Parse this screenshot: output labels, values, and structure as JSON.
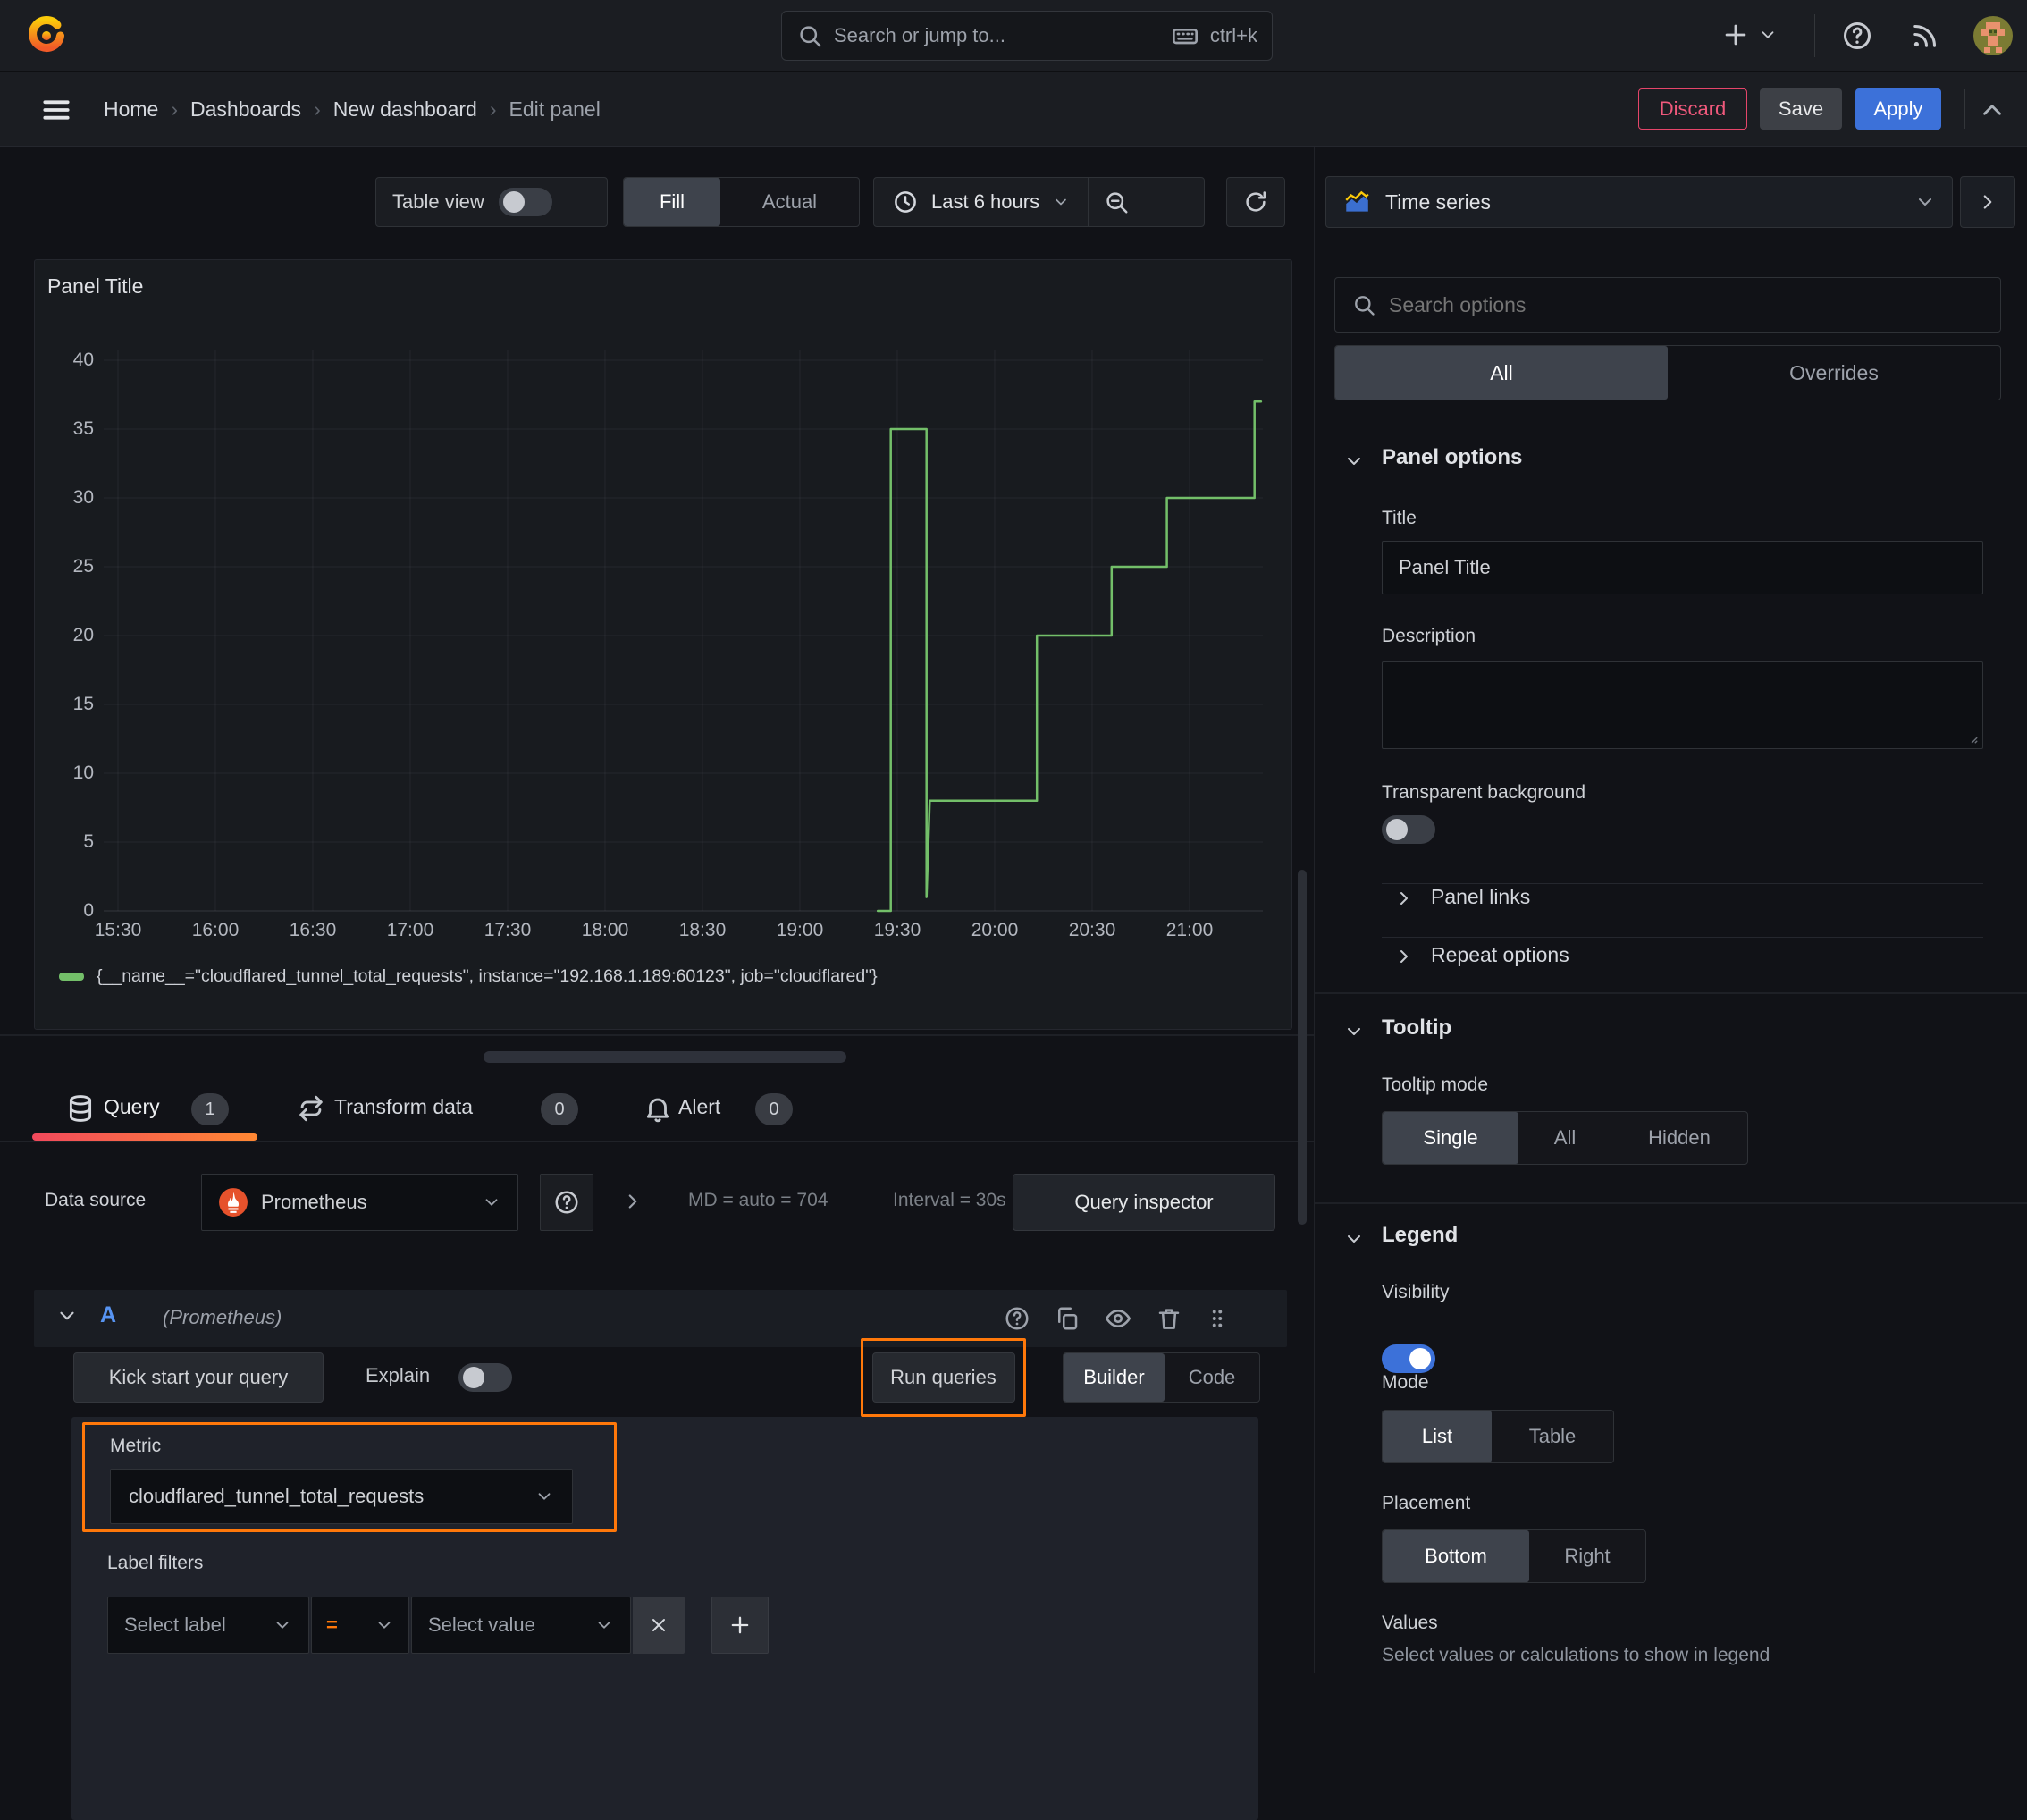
{
  "topbar": {
    "search_placeholder": "Search or jump to...",
    "search_shortcut": "ctrl+k"
  },
  "breadcrumb": {
    "items": [
      "Home",
      "Dashboards",
      "New dashboard",
      "Edit panel"
    ],
    "separator": "›"
  },
  "actions": {
    "discard": "Discard",
    "save": "Save",
    "apply": "Apply"
  },
  "toolbar": {
    "table_view": "Table view",
    "fill": "Fill",
    "actual": "Actual",
    "time_range": "Last 6 hours"
  },
  "panel": {
    "title": "Panel Title"
  },
  "chart_data": {
    "type": "line",
    "title": "Panel Title",
    "x_axis": {
      "note": "minutes after 15:00",
      "tick_minutes": [
        30,
        60,
        90,
        120,
        150,
        180,
        210,
        240,
        270,
        300,
        330,
        360
      ],
      "tick_labels": [
        "15:30",
        "16:00",
        "16:30",
        "17:00",
        "17:30",
        "18:00",
        "18:30",
        "19:00",
        "19:30",
        "20:00",
        "20:30",
        "21:00"
      ],
      "range_minutes": [
        26,
        382
      ]
    },
    "y_axis": {
      "ticks": [
        0,
        5,
        10,
        15,
        20,
        25,
        30,
        35,
        40
      ],
      "range": [
        0,
        40.8
      ]
    },
    "series": [
      {
        "name": "{__name__=\"cloudflared_tunnel_total_requests\", instance=\"192.168.1.189:60123\", job=\"cloudflared\"}",
        "color": "#73bf69",
        "step_points": [
          [
            264,
            0
          ],
          [
            268,
            0
          ],
          [
            268,
            35
          ],
          [
            279,
            35
          ],
          [
            279,
            1
          ],
          [
            280,
            8
          ],
          [
            313,
            8
          ],
          [
            313,
            20
          ],
          [
            336,
            20
          ],
          [
            336,
            25
          ],
          [
            353,
            25
          ],
          [
            353,
            30
          ],
          [
            380,
            30
          ],
          [
            380,
            37
          ],
          [
            382,
            37
          ]
        ]
      }
    ],
    "legend_position": "bottom",
    "grid": true
  },
  "tabs": {
    "query": "Query",
    "query_count": "1",
    "transform": "Transform data",
    "transform_count": "0",
    "alert": "Alert",
    "alert_count": "0"
  },
  "datasource": {
    "label": "Data source",
    "name": "Prometheus",
    "md_text": "MD = auto = 704",
    "interval_text": "Interval = 30s",
    "inspector": "Query inspector"
  },
  "query": {
    "ref": "A",
    "ds_hint": "(Prometheus)",
    "kickstart": "Kick start your query",
    "explain": "Explain",
    "run": "Run queries",
    "builder": "Builder",
    "code": "Code",
    "metric_label": "Metric",
    "metric_value": "cloudflared_tunnel_total_requests",
    "label_filters": "Label filters",
    "select_label": "Select label",
    "operator": "=",
    "select_value": "Select value"
  },
  "options": {
    "viz_name": "Time series",
    "search_placeholder": "Search options",
    "tab_all": "All",
    "tab_overrides": "Overrides",
    "panel_options": "Panel options",
    "title_label": "Title",
    "title_value": "Panel Title",
    "description_label": "Description",
    "transparent_label": "Transparent background",
    "panel_links": "Panel links",
    "repeat_options": "Repeat options",
    "tooltip": "Tooltip",
    "tooltip_mode": "Tooltip mode",
    "tt_single": "Single",
    "tt_all": "All",
    "tt_hidden": "Hidden",
    "legend": "Legend",
    "visibility": "Visibility",
    "mode": "Mode",
    "mode_list": "List",
    "mode_table": "Table",
    "placement": "Placement",
    "pl_bottom": "Bottom",
    "pl_right": "Right",
    "values": "Values",
    "values_hint": "Select values or calculations to show in legend"
  },
  "state": {
    "table_view_on": false,
    "explain_on": false,
    "transparent_on": false,
    "visibility_on": true
  },
  "colors": {
    "accent_blue": "#3c71d9",
    "accent_orange": "#ff780a",
    "destructive": "#eb4d6d",
    "series_green": "#73bf69"
  }
}
